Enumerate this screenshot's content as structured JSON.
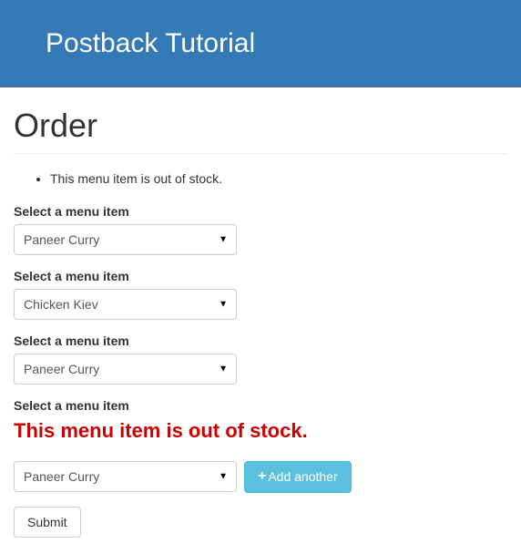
{
  "navbar": {
    "title": "Postback Tutorial"
  },
  "page": {
    "title": "Order"
  },
  "form_errors": [
    "This menu item is out of stock."
  ],
  "form": {
    "rows": [
      {
        "label": "Select a menu item",
        "selected": "Paneer Curry",
        "error": null,
        "has_add_button": false
      },
      {
        "label": "Select a menu item",
        "selected": "Chicken Kiev",
        "error": null,
        "has_add_button": false
      },
      {
        "label": "Select a menu item",
        "selected": "Paneer Curry",
        "error": null,
        "has_add_button": false
      },
      {
        "label": "Select a menu item",
        "selected": "Paneer Curry",
        "error": "This menu item is out of stock.",
        "has_add_button": true
      }
    ],
    "add_button_label": "Add another",
    "submit_label": "Submit"
  }
}
